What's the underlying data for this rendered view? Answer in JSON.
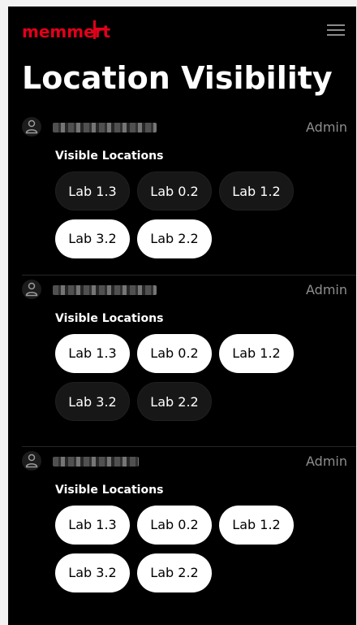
{
  "header": {
    "logo_text": "memmert",
    "logo_color": "#e2001a",
    "menu_icon": "hamburger-menu-icon"
  },
  "page_title": "Location Visibility",
  "users": [
    {
      "role": "Admin",
      "visible_label": "Visible Locations",
      "locations": [
        {
          "label": "Lab 1.3",
          "selected": false
        },
        {
          "label": "Lab 0.2",
          "selected": false
        },
        {
          "label": "Lab 1.2",
          "selected": false
        },
        {
          "label": "Lab 3.2",
          "selected": true
        },
        {
          "label": "Lab 2.2",
          "selected": true
        }
      ]
    },
    {
      "role": "Admin",
      "visible_label": "Visible Locations",
      "locations": [
        {
          "label": "Lab 1.3",
          "selected": true
        },
        {
          "label": "Lab 0.2",
          "selected": true
        },
        {
          "label": "Lab 1.2",
          "selected": true
        },
        {
          "label": "Lab 3.2",
          "selected": false
        },
        {
          "label": "Lab 2.2",
          "selected": false
        }
      ]
    },
    {
      "role": "Admin",
      "visible_label": "Visible Locations",
      "locations": [
        {
          "label": "Lab 1.3",
          "selected": true
        },
        {
          "label": "Lab 0.2",
          "selected": true
        },
        {
          "label": "Lab 1.2",
          "selected": true
        },
        {
          "label": "Lab 3.2",
          "selected": true
        },
        {
          "label": "Lab 2.2",
          "selected": true
        }
      ]
    }
  ],
  "colors": {
    "background": "#000000",
    "chip_selected_bg": "#ffffff",
    "chip_unselected_bg": "#171717",
    "role_text": "#8e8e8e"
  }
}
